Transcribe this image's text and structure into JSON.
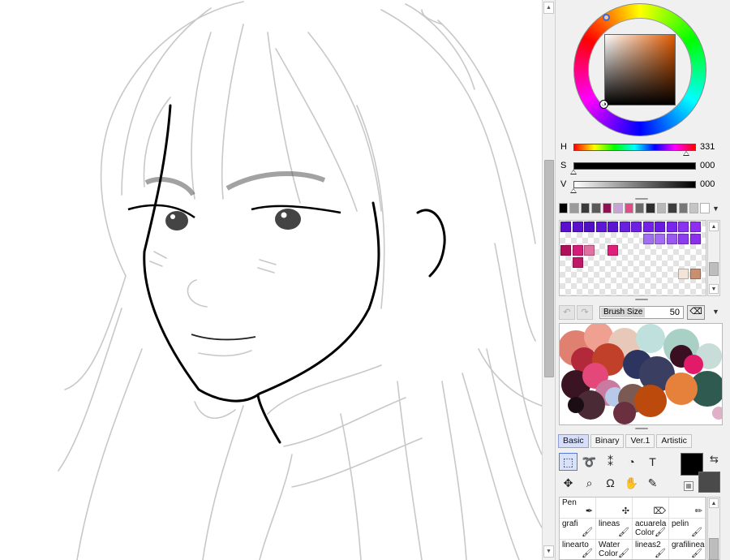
{
  "color_picker": {
    "hue_label": "H",
    "hue_value": "331",
    "sat_label": "S",
    "sat_value": "000",
    "val_label": "V",
    "val_value": "000",
    "hue_level": 0.92,
    "sat_level": 0.0,
    "val_level": 0.0
  },
  "history_swatches": [
    "#000000",
    "#9a9a9a",
    "#3a3a3a",
    "#5a5a5a",
    "#8f1055",
    "#c8a2d8",
    "#e24c86",
    "#6b6b6b",
    "#2e2e2e",
    "#b8b8b8",
    "#3d3d3d",
    "#777777",
    "#c4c4c4",
    "#ffffff"
  ],
  "palette": [
    {
      "c": "#5a0fd0",
      "r": 0,
      "col": 0
    },
    {
      "c": "#5a12cc",
      "r": 0,
      "col": 1
    },
    {
      "c": "#4f10c6",
      "r": 0,
      "col": 2
    },
    {
      "c": "#5d18d6",
      "r": 0,
      "col": 3
    },
    {
      "c": "#5b14cf",
      "r": 0,
      "col": 4
    },
    {
      "c": "#6a1ee0",
      "r": 0,
      "col": 5
    },
    {
      "c": "#6e20e2",
      "r": 0,
      "col": 6
    },
    {
      "c": "#7422e8",
      "r": 0,
      "col": 7
    },
    {
      "c": "#6a1de0",
      "r": 0,
      "col": 8
    },
    {
      "c": "#7a26ec",
      "r": 0,
      "col": 9
    },
    {
      "c": "#8a32f2",
      "r": 0,
      "col": 10
    },
    {
      "c": "#8e2ef0",
      "r": 0,
      "col": 11
    },
    {
      "c": "#a070f0",
      "r": 1,
      "col": 7
    },
    {
      "c": "#a46cf2",
      "r": 1,
      "col": 8
    },
    {
      "c": "#9a58f0",
      "r": 1,
      "col": 9
    },
    {
      "c": "#8c3cf0",
      "r": 1,
      "col": 10
    },
    {
      "c": "#8a30ec",
      "r": 1,
      "col": 11
    },
    {
      "c": "#b0105a",
      "r": 2,
      "col": 0
    },
    {
      "c": "#d41c78",
      "r": 2,
      "col": 1
    },
    {
      "c": "#e070a0",
      "r": 2,
      "col": 2
    },
    {
      "c": "#e01f7a",
      "r": 2,
      "col": 4
    },
    {
      "c": "#c01868",
      "r": 3,
      "col": 1
    },
    {
      "c": "#f2e4d8",
      "r": 4,
      "col": 10
    },
    {
      "c": "#c99070",
      "r": 4,
      "col": 11
    }
  ],
  "brush_bar": {
    "size_label": "Brush Size",
    "size_value": "50"
  },
  "tool_tabs": [
    {
      "label": "Basic",
      "active": true
    },
    {
      "label": "Binary",
      "active": false
    },
    {
      "label": "Ver.1",
      "active": false
    },
    {
      "label": "Artistic",
      "active": false
    }
  ],
  "tools": [
    {
      "icon": "rect-select-icon",
      "glyph": "⬚",
      "active": true
    },
    {
      "icon": "lasso-icon",
      "glyph": "➰",
      "active": false
    },
    {
      "icon": "magic-wand-icon",
      "glyph": "⁑",
      "active": false
    },
    {
      "icon": "bucket-icon",
      "glyph": "◔",
      "active": false
    },
    {
      "icon": "text-icon",
      "glyph": "T",
      "active": false
    },
    {
      "icon": "move-icon",
      "glyph": "✥",
      "active": false
    },
    {
      "icon": "zoom-icon",
      "glyph": "⌕",
      "active": false
    },
    {
      "icon": "rotate-icon",
      "glyph": "Ω",
      "active": false
    },
    {
      "icon": "hand-icon",
      "glyph": "✋",
      "active": false
    },
    {
      "icon": "eyedropper-icon",
      "glyph": "✎",
      "active": false
    }
  ],
  "brushes": [
    {
      "label": "Pen",
      "icon": "pen-icon"
    },
    {
      "label": "",
      "icon": "airbrush-icon"
    },
    {
      "label": "",
      "icon": "eraser-brush-icon"
    },
    {
      "label": "",
      "icon": "pencil-brush-icon"
    },
    {
      "label": "grafi",
      "icon": "brush-icon"
    },
    {
      "label": "lineas",
      "icon": "brush-icon"
    },
    {
      "label": "acuarela Color",
      "icon": "watercolor-icon"
    },
    {
      "label": "pelin",
      "icon": "brush-icon"
    },
    {
      "label": "linearto",
      "icon": "brush-icon"
    },
    {
      "label": "Water Color",
      "icon": "watercolor-icon"
    },
    {
      "label": "lineas2",
      "icon": "brush-icon"
    },
    {
      "label": "grafilinea",
      "icon": "brush-icon"
    }
  ]
}
